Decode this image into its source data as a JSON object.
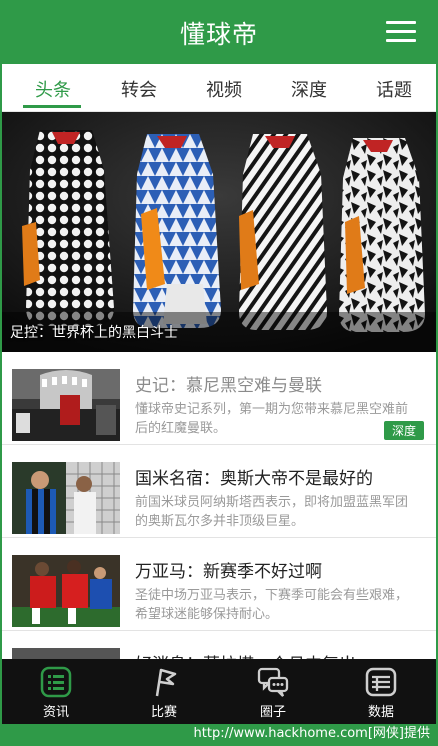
{
  "header": {
    "title": "懂球帝",
    "menu_icon": "hamburger-menu-icon"
  },
  "tabs": [
    {
      "label": "头条",
      "active": true
    },
    {
      "label": "转会",
      "active": false
    },
    {
      "label": "视频",
      "active": false
    },
    {
      "label": "深度",
      "active": false
    },
    {
      "label": "话题",
      "active": false
    }
  ],
  "hero": {
    "caption": "足控：世界杯上的黑白斗士"
  },
  "news": [
    {
      "title": "史记：慕尼黑空难与曼联",
      "summary": "懂球帝史记系列，第一期为您带来慕尼黑空难前后的红魔曼联。",
      "tag": "深度",
      "read": true
    },
    {
      "title": "国米名宿：奥斯大帝不是最好的",
      "summary": "前国米球员阿纳斯塔西表示，即将加盟蓝黑军团的奥斯瓦尔多并非顶级巨星。",
      "read": false
    },
    {
      "title": "万亚马：新赛季不好过啊",
      "summary": "圣徒中场万亚马表示，下赛季可能会有些艰难，希望球迷能够保持耐心。",
      "read": false
    },
    {
      "title": "好消息！莫拉塔一个月内复出",
      "read": false
    }
  ],
  "bottom_nav": [
    {
      "label": "资讯",
      "icon": "news-list-icon"
    },
    {
      "label": "比赛",
      "icon": "match-flag-icon"
    },
    {
      "label": "圈子",
      "icon": "chat-bubbles-icon"
    },
    {
      "label": "数据",
      "icon": "data-table-icon"
    }
  ],
  "watermark": "http://www.hackhome.com[网侠]提供",
  "colors": {
    "brand": "#2f9a48",
    "nav_bg": "#111111",
    "read_title": "#8b8b8b"
  }
}
